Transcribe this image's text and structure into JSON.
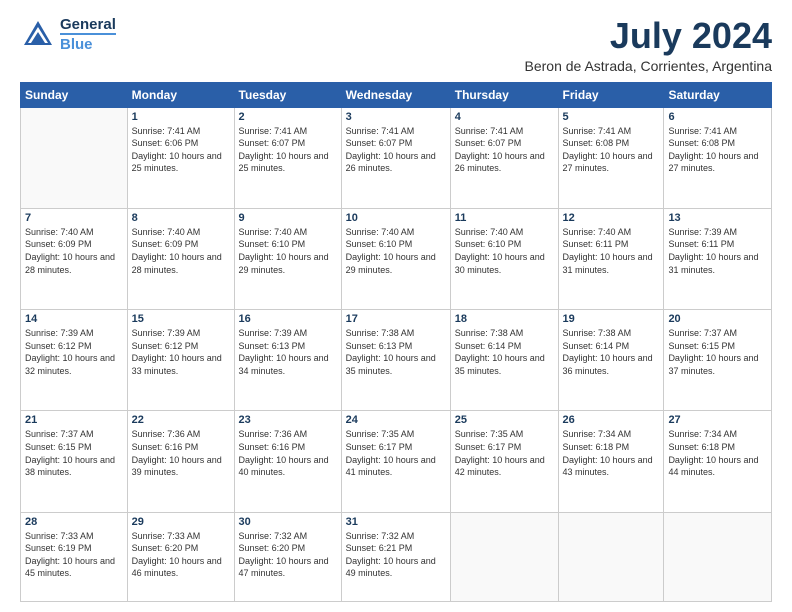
{
  "logo": {
    "line1": "General",
    "line2": "Blue"
  },
  "title": "July 2024",
  "subtitle": "Beron de Astrada, Corrientes, Argentina",
  "headers": [
    "Sunday",
    "Monday",
    "Tuesday",
    "Wednesday",
    "Thursday",
    "Friday",
    "Saturday"
  ],
  "weeks": [
    [
      null,
      {
        "day": "1",
        "sunrise": "7:41 AM",
        "sunset": "6:06 PM",
        "daylight": "10 hours and 25 minutes."
      },
      {
        "day": "2",
        "sunrise": "7:41 AM",
        "sunset": "6:07 PM",
        "daylight": "10 hours and 25 minutes."
      },
      {
        "day": "3",
        "sunrise": "7:41 AM",
        "sunset": "6:07 PM",
        "daylight": "10 hours and 26 minutes."
      },
      {
        "day": "4",
        "sunrise": "7:41 AM",
        "sunset": "6:07 PM",
        "daylight": "10 hours and 26 minutes."
      },
      {
        "day": "5",
        "sunrise": "7:41 AM",
        "sunset": "6:08 PM",
        "daylight": "10 hours and 27 minutes."
      },
      {
        "day": "6",
        "sunrise": "7:41 AM",
        "sunset": "6:08 PM",
        "daylight": "10 hours and 27 minutes."
      }
    ],
    [
      {
        "day": "7",
        "sunrise": "7:40 AM",
        "sunset": "6:09 PM",
        "daylight": "10 hours and 28 minutes."
      },
      {
        "day": "8",
        "sunrise": "7:40 AM",
        "sunset": "6:09 PM",
        "daylight": "10 hours and 28 minutes."
      },
      {
        "day": "9",
        "sunrise": "7:40 AM",
        "sunset": "6:10 PM",
        "daylight": "10 hours and 29 minutes."
      },
      {
        "day": "10",
        "sunrise": "7:40 AM",
        "sunset": "6:10 PM",
        "daylight": "10 hours and 29 minutes."
      },
      {
        "day": "11",
        "sunrise": "7:40 AM",
        "sunset": "6:10 PM",
        "daylight": "10 hours and 30 minutes."
      },
      {
        "day": "12",
        "sunrise": "7:40 AM",
        "sunset": "6:11 PM",
        "daylight": "10 hours and 31 minutes."
      },
      {
        "day": "13",
        "sunrise": "7:39 AM",
        "sunset": "6:11 PM",
        "daylight": "10 hours and 31 minutes."
      }
    ],
    [
      {
        "day": "14",
        "sunrise": "7:39 AM",
        "sunset": "6:12 PM",
        "daylight": "10 hours and 32 minutes."
      },
      {
        "day": "15",
        "sunrise": "7:39 AM",
        "sunset": "6:12 PM",
        "daylight": "10 hours and 33 minutes."
      },
      {
        "day": "16",
        "sunrise": "7:39 AM",
        "sunset": "6:13 PM",
        "daylight": "10 hours and 34 minutes."
      },
      {
        "day": "17",
        "sunrise": "7:38 AM",
        "sunset": "6:13 PM",
        "daylight": "10 hours and 35 minutes."
      },
      {
        "day": "18",
        "sunrise": "7:38 AM",
        "sunset": "6:14 PM",
        "daylight": "10 hours and 35 minutes."
      },
      {
        "day": "19",
        "sunrise": "7:38 AM",
        "sunset": "6:14 PM",
        "daylight": "10 hours and 36 minutes."
      },
      {
        "day": "20",
        "sunrise": "7:37 AM",
        "sunset": "6:15 PM",
        "daylight": "10 hours and 37 minutes."
      }
    ],
    [
      {
        "day": "21",
        "sunrise": "7:37 AM",
        "sunset": "6:15 PM",
        "daylight": "10 hours and 38 minutes."
      },
      {
        "day": "22",
        "sunrise": "7:36 AM",
        "sunset": "6:16 PM",
        "daylight": "10 hours and 39 minutes."
      },
      {
        "day": "23",
        "sunrise": "7:36 AM",
        "sunset": "6:16 PM",
        "daylight": "10 hours and 40 minutes."
      },
      {
        "day": "24",
        "sunrise": "7:35 AM",
        "sunset": "6:17 PM",
        "daylight": "10 hours and 41 minutes."
      },
      {
        "day": "25",
        "sunrise": "7:35 AM",
        "sunset": "6:17 PM",
        "daylight": "10 hours and 42 minutes."
      },
      {
        "day": "26",
        "sunrise": "7:34 AM",
        "sunset": "6:18 PM",
        "daylight": "10 hours and 43 minutes."
      },
      {
        "day": "27",
        "sunrise": "7:34 AM",
        "sunset": "6:18 PM",
        "daylight": "10 hours and 44 minutes."
      }
    ],
    [
      {
        "day": "28",
        "sunrise": "7:33 AM",
        "sunset": "6:19 PM",
        "daylight": "10 hours and 45 minutes."
      },
      {
        "day": "29",
        "sunrise": "7:33 AM",
        "sunset": "6:20 PM",
        "daylight": "10 hours and 46 minutes."
      },
      {
        "day": "30",
        "sunrise": "7:32 AM",
        "sunset": "6:20 PM",
        "daylight": "10 hours and 47 minutes."
      },
      {
        "day": "31",
        "sunrise": "7:32 AM",
        "sunset": "6:21 PM",
        "daylight": "10 hours and 49 minutes."
      },
      null,
      null,
      null
    ]
  ]
}
